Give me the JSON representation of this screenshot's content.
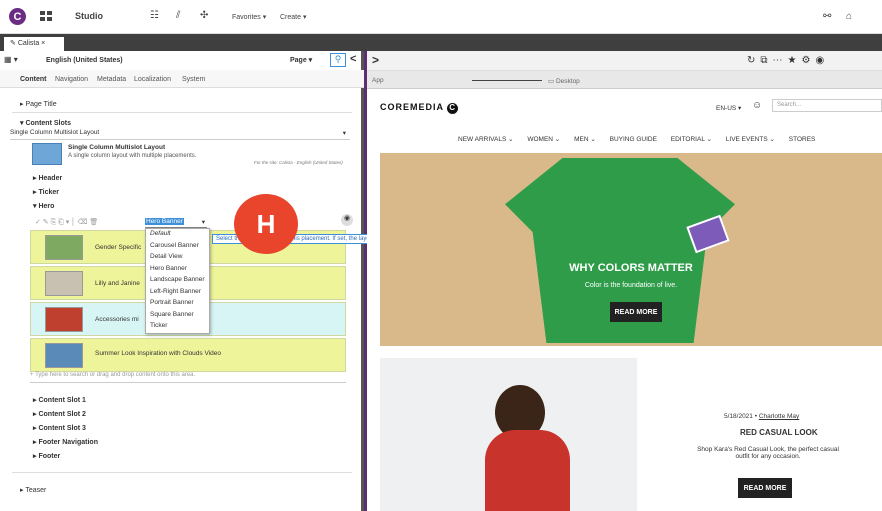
{
  "topbar": {
    "title": "Studio",
    "favorites": "Favorites",
    "create": "Create"
  },
  "tab": {
    "label": "Calista"
  },
  "left": {
    "locale": "English (United States)",
    "page_btn": "Page",
    "tabs": [
      "Content",
      "Navigation",
      "Metadata",
      "Localization",
      "System"
    ],
    "page_title": "Page Title",
    "content_slots": "Content Slots",
    "layout_select": "Single Column Multislot Layout",
    "layout_name": "Single Column Multislot Layout",
    "layout_desc": "A single column layout with multiple placements.",
    "site_note": "For the site: Calista - English (United States)",
    "header": "Header",
    "ticker": "Ticker",
    "hero": "Hero",
    "hero_select": "Hero Banner",
    "tooltip": "Select the layout variant for this placement. If set, the layout variant affects how the placement is rendered.",
    "rows": [
      "Gender Specific",
      "Lilly and Janine",
      "Accessories mi",
      "Summer Look Inspiration with Clouds Video"
    ],
    "dropdown": [
      "Default",
      "Carousel Banner",
      "Detail View",
      "Hero Banner",
      "Landscape Banner",
      "Left-Right Banner",
      "Portrait Banner",
      "Square Banner",
      "Ticker"
    ],
    "add_placeholder": "Type here to search or drag and drop content onto this area.",
    "slots": [
      "Content Slot 1",
      "Content Slot 2",
      "Content Slot 3",
      "Footer Navigation",
      "Footer"
    ],
    "teaser": "Teaser"
  },
  "right": {
    "app": "App",
    "device": "Desktop",
    "brand": "COREMEDIA",
    "locale": "EN-US",
    "search_placeholder": "Search...",
    "nav": [
      "NEW ARRIVALS",
      "WOMEN",
      "MEN",
      "BUYING GUIDE",
      "EDITORIAL",
      "LIVE EVENTS",
      "STORES"
    ],
    "hero_title": "WHY COLORS MATTER",
    "hero_sub": "Color is the foundation of live.",
    "hero_btn": "READ MORE",
    "date": "5/18/2021",
    "author": "Charlotte May",
    "article_title": "RED CASUAL LOOK",
    "article_text": "Shop Kara's Red Casual Look, the perfect casual outfit for any occasion.",
    "article_btn": "READ MORE"
  },
  "overlay": {
    "letter": "H"
  }
}
